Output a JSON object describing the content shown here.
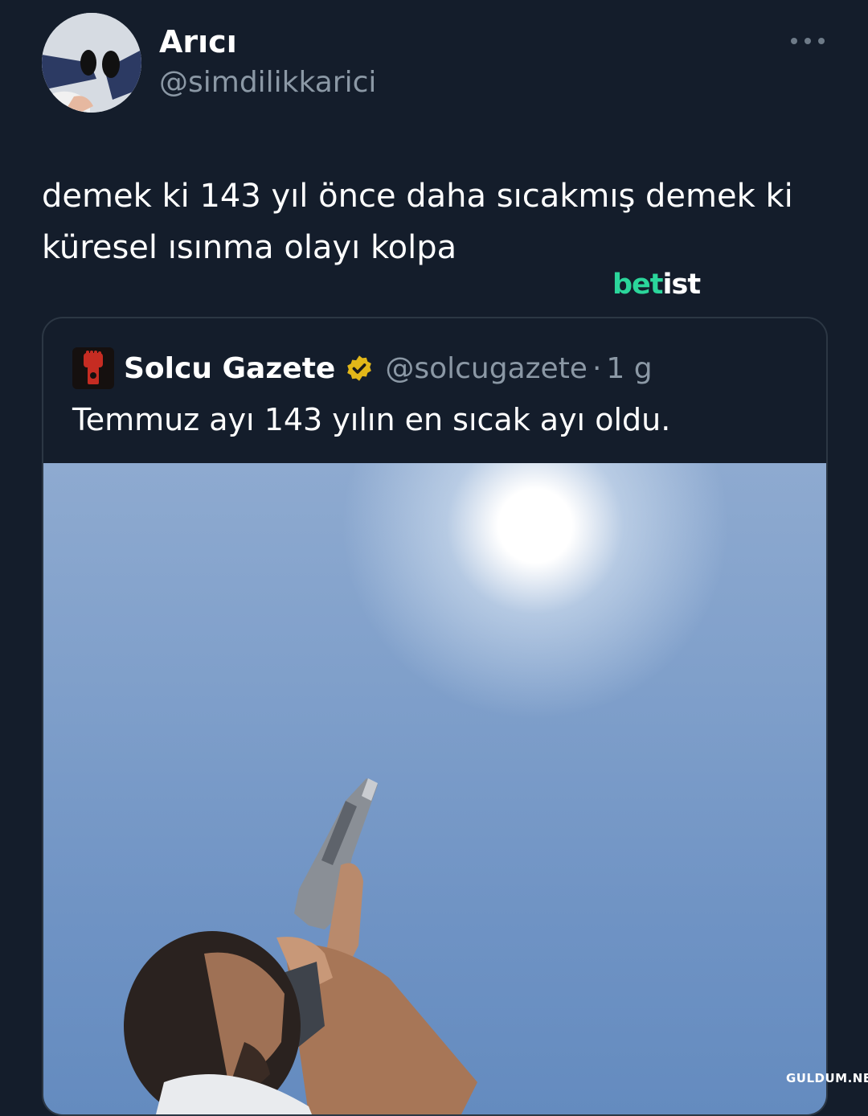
{
  "author": {
    "display_name": "Arıcı",
    "handle": "@simdilikkarici"
  },
  "tweet": {
    "text_line1": "demek ki 143 yıl önce daha sıcakmış demek ki",
    "text_line2": "küresel ısınma olayı kolpa"
  },
  "watermark": {
    "part1": "bet",
    "part2": "ist"
  },
  "quoted_tweet": {
    "display_name": "Solcu Gazete",
    "handle": "@solcugazete",
    "separator": "·",
    "time": "1 g",
    "text": "Temmuz ayı 143 yılın en sıcak ayı oldu."
  },
  "site_watermark": "GULDUM.NET",
  "icons": {
    "more": "more-horizontal-icon",
    "verified": "verified-badge-icon",
    "logo": "fist-logo-icon"
  },
  "colors": {
    "background": "#141d2b",
    "muted_text": "#8b98a5",
    "brand_green": "#2bd69b",
    "badge_gold": "#e2b719"
  }
}
